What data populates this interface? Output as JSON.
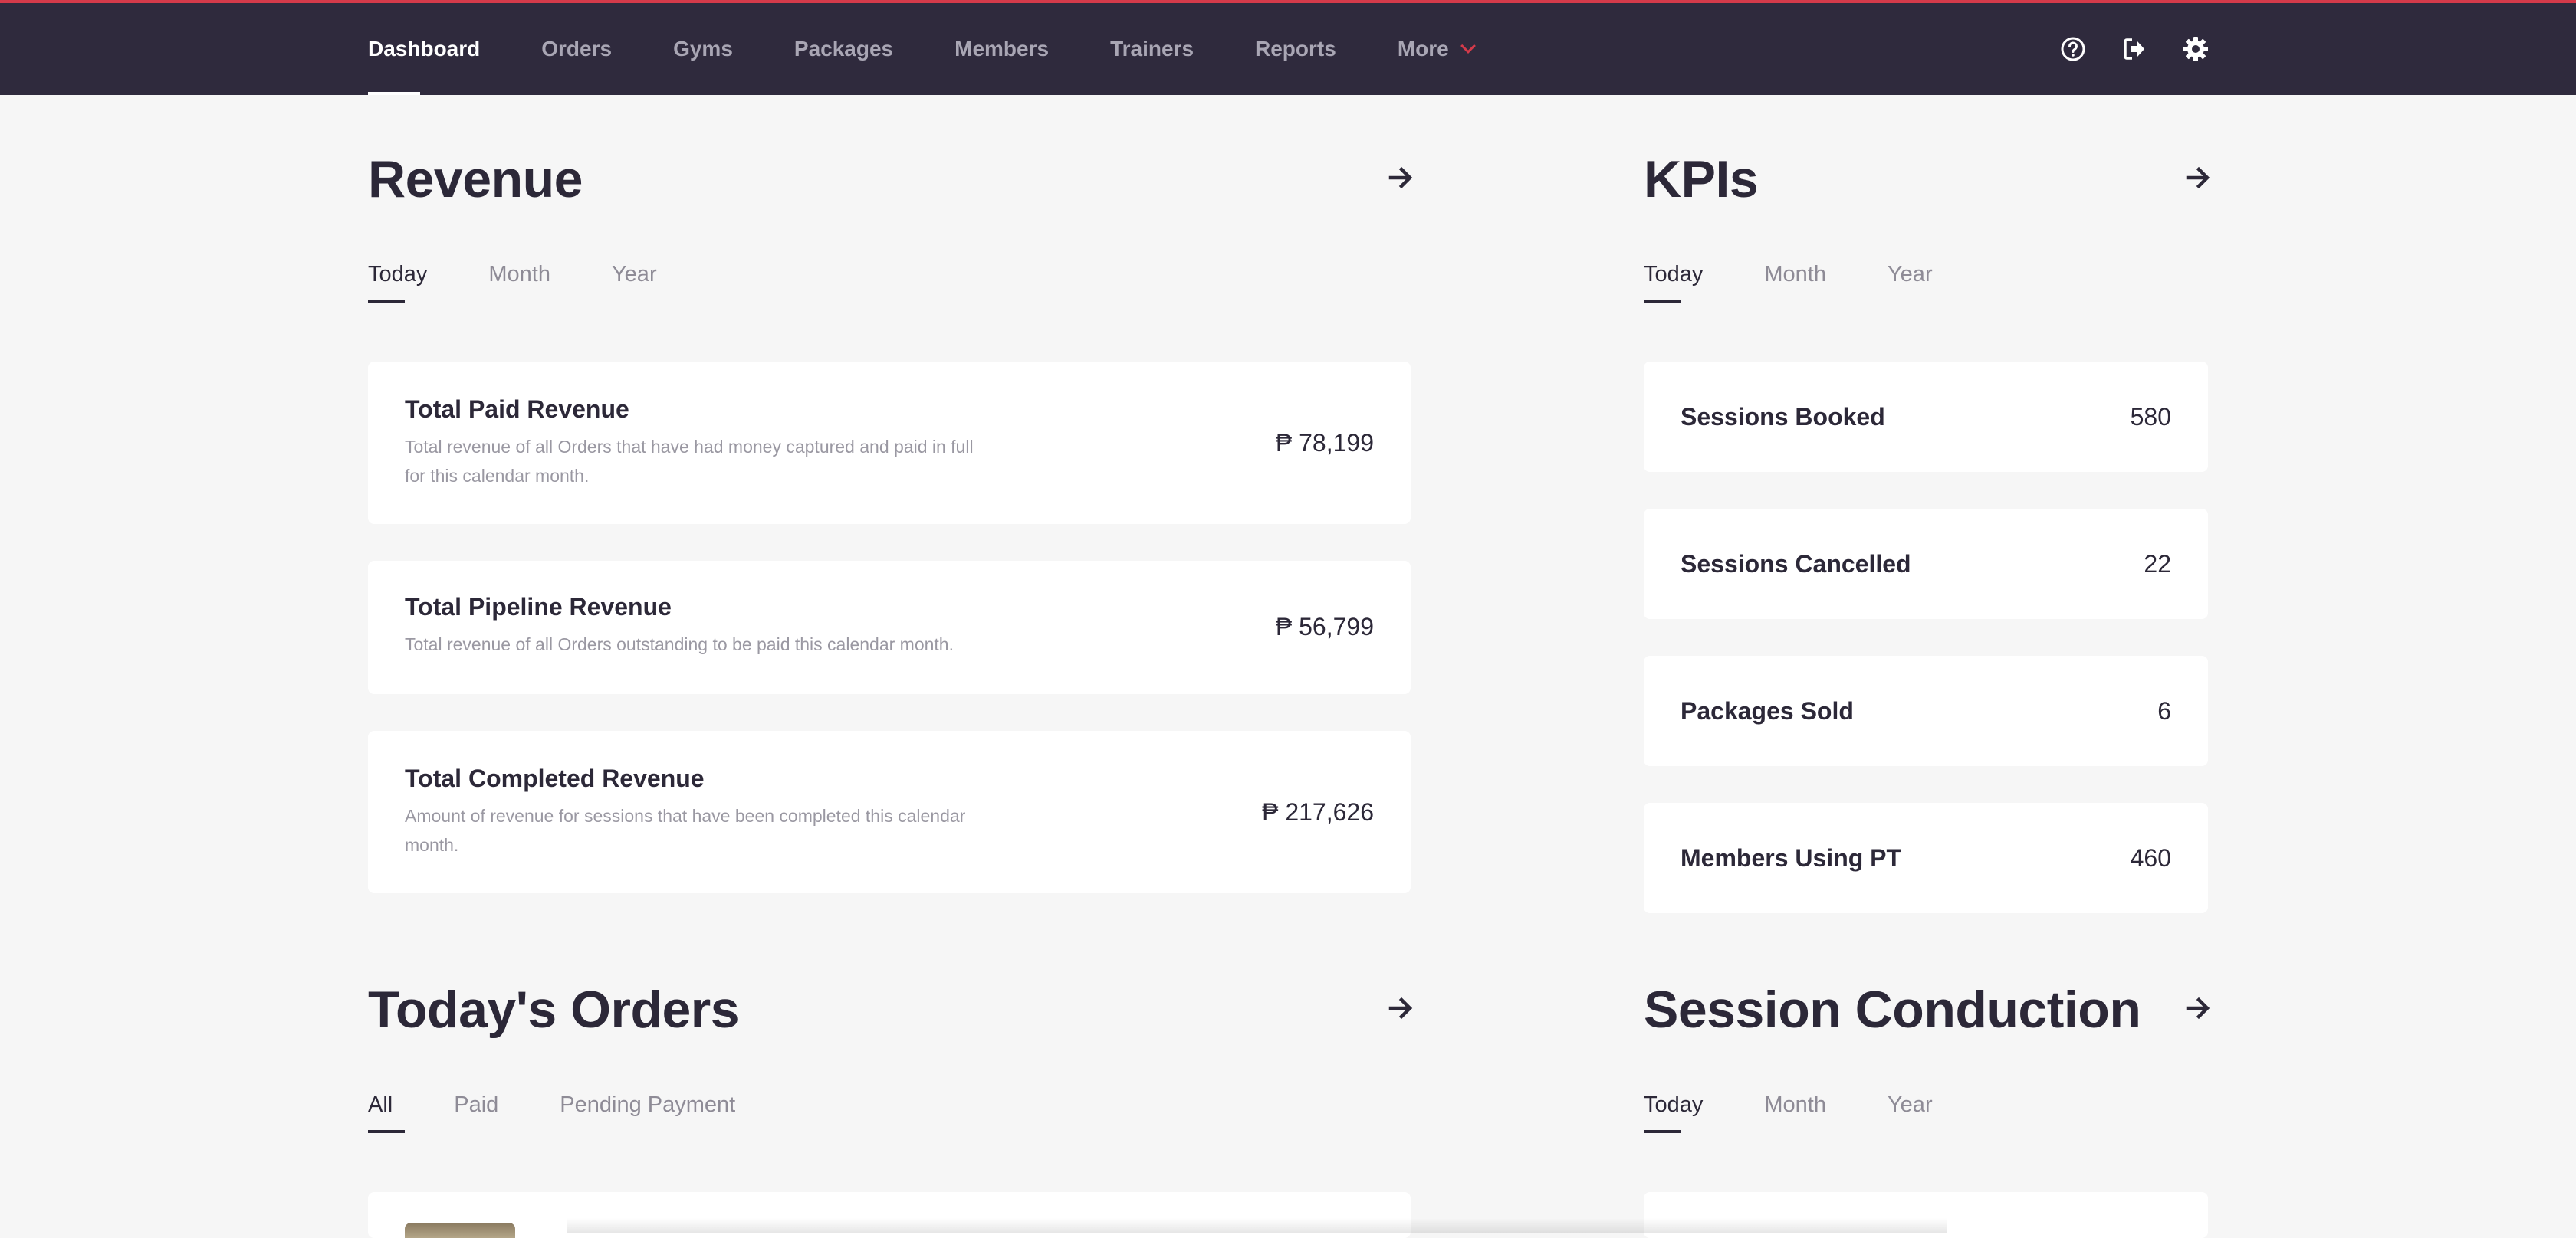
{
  "nav": {
    "items": [
      {
        "label": "Dashboard",
        "active": true
      },
      {
        "label": "Orders"
      },
      {
        "label": "Gyms"
      },
      {
        "label": "Packages"
      },
      {
        "label": "Members"
      },
      {
        "label": "Trainers"
      },
      {
        "label": "Reports"
      },
      {
        "label": "More"
      }
    ],
    "icons": [
      "help-circle-icon",
      "logout-icon",
      "gear-icon"
    ]
  },
  "revenue": {
    "title": "Revenue",
    "tabs": [
      "Today",
      "Month",
      "Year"
    ],
    "active_tab": "Today",
    "cards": [
      {
        "title": "Total Paid Revenue",
        "description": "Total revenue of all Orders that have had money captured and paid in full for this calendar month.",
        "value": "₱ 78,199"
      },
      {
        "title": "Total Pipeline Revenue",
        "description": "Total revenue of all Orders outstanding to be paid this calendar month.",
        "value": "₱ 56,799"
      },
      {
        "title": "Total Completed Revenue",
        "description": "Amount of revenue for sessions that have been completed this calendar month.",
        "value": "₱ 217,626"
      }
    ]
  },
  "kpis": {
    "title": "KPIs",
    "tabs": [
      "Today",
      "Month",
      "Year"
    ],
    "active_tab": "Today",
    "items": [
      {
        "label": "Sessions Booked",
        "value": "580"
      },
      {
        "label": "Sessions Cancelled",
        "value": "22"
      },
      {
        "label": "Packages Sold",
        "value": "6"
      },
      {
        "label": "Members Using PT",
        "value": "460"
      }
    ]
  },
  "orders": {
    "title": "Today's Orders",
    "tabs": [
      "All",
      "Paid",
      "Pending Payment"
    ],
    "active_tab": "All"
  },
  "sessions": {
    "title": "Session Conduction",
    "tabs": [
      "Today",
      "Month",
      "Year"
    ],
    "active_tab": "Today"
  },
  "colors": {
    "nav_bg": "#2f2a3d",
    "accent": "#d43a4a",
    "page_bg": "#f6f6f6",
    "text": "#2c2838"
  }
}
